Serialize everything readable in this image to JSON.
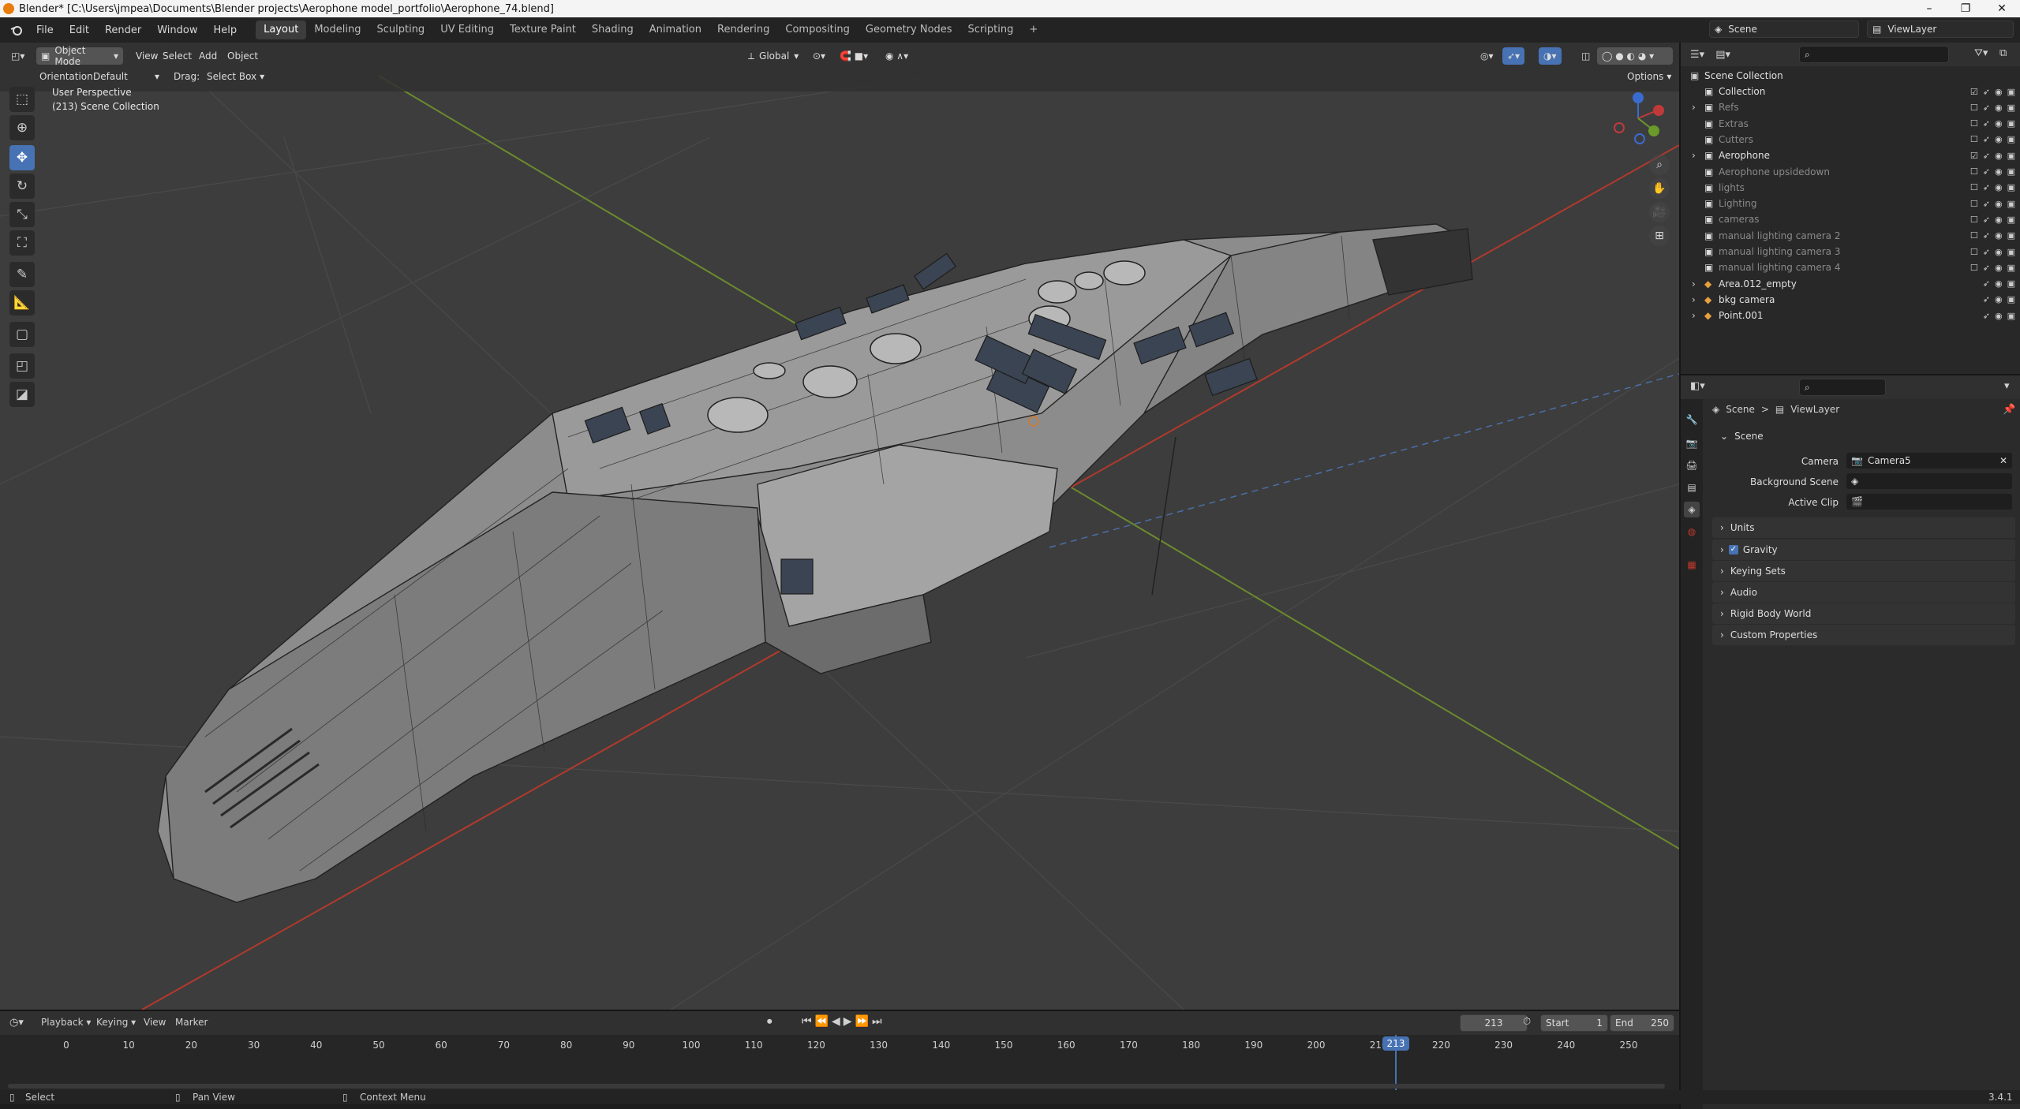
{
  "titlebar": {
    "title": "Blender* [C:\\Users\\jmpea\\Documents\\Blender projects\\Aerophone model_portfolio\\Aerophone_74.blend]",
    "minimize": "–",
    "maximize": "❐",
    "close": "✕"
  },
  "menubar": {
    "menus": [
      "File",
      "Edit",
      "Render",
      "Window",
      "Help"
    ],
    "workspaces": [
      "Layout",
      "Modeling",
      "Sculpting",
      "UV Editing",
      "Texture Paint",
      "Shading",
      "Animation",
      "Rendering",
      "Compositing",
      "Geometry Nodes",
      "Scripting"
    ],
    "active_workspace": "Layout",
    "add_workspace": "+",
    "scene_name": "Scene",
    "view_layer": "ViewLayer"
  },
  "viewport_header": {
    "mode": "Object Mode",
    "menus": [
      "View",
      "Select",
      "Add",
      "Object"
    ],
    "transform_orientation": "Global",
    "orientation_label": "Orientation:",
    "orientation_value": "Default",
    "drag_label": "Drag:",
    "drag_value": "Select Box",
    "options": "Options"
  },
  "viewport_overlay": {
    "perspective": "User Perspective",
    "collection": "(213) Scene Collection"
  },
  "outliner": {
    "root": "Scene Collection",
    "items": [
      {
        "label": "Collection",
        "checked": true,
        "dim": false
      },
      {
        "label": "Refs",
        "checked": false,
        "dim": true
      },
      {
        "label": "Extras",
        "checked": false,
        "dim": true
      },
      {
        "label": "Cutters",
        "checked": false,
        "dim": true
      },
      {
        "label": "Aerophone",
        "checked": true,
        "dim": false
      },
      {
        "label": "Aerophone upsidedown",
        "checked": false,
        "dim": true
      },
      {
        "label": "lights",
        "checked": false,
        "dim": true
      },
      {
        "label": "Lighting",
        "checked": false,
        "dim": true
      },
      {
        "label": "cameras",
        "checked": false,
        "dim": true
      },
      {
        "label": "manual lighting camera 2",
        "checked": false,
        "dim": true
      },
      {
        "label": "manual lighting camera 3",
        "checked": false,
        "dim": true
      },
      {
        "label": "manual lighting camera 4",
        "checked": false,
        "dim": true
      },
      {
        "label": "Area.012_empty",
        "checked": null,
        "dim": false
      },
      {
        "label": "bkg camera",
        "checked": null,
        "dim": false
      },
      {
        "label": "Point.001",
        "checked": null,
        "dim": false
      }
    ]
  },
  "properties": {
    "breadcrumb_scene": "Scene",
    "breadcrumb_sep": ">",
    "breadcrumb_viewlayer": "ViewLayer",
    "panel_scene": "Scene",
    "camera_label": "Camera",
    "camera_value": "Camera5",
    "background_scene_label": "Background Scene",
    "active_clip_label": "Active Clip",
    "subpanels": [
      "Units",
      "Gravity",
      "Keying Sets",
      "Audio",
      "Rigid Body World",
      "Custom Properties"
    ]
  },
  "timeline": {
    "menus": [
      "Playback",
      "Keying",
      "View",
      "Marker"
    ],
    "current_frame": "213",
    "start_label": "Start",
    "start_value": "1",
    "end_label": "End",
    "end_value": "250",
    "ticks": [
      "0",
      "10",
      "20",
      "30",
      "40",
      "50",
      "60",
      "70",
      "80",
      "90",
      "100",
      "110",
      "120",
      "130",
      "140",
      "150",
      "160",
      "170",
      "180",
      "190",
      "200",
      "210",
      "220",
      "230",
      "240",
      "250"
    ],
    "playhead_label": "213"
  },
  "statusbar": {
    "select": "Select",
    "pan": "Pan View",
    "context": "Context Menu",
    "version": "3.4.1"
  },
  "colors": {
    "accent": "#4772b3",
    "playhead": "#4772b3",
    "x_axis": "#c0392b",
    "y_axis": "#7da03a"
  }
}
